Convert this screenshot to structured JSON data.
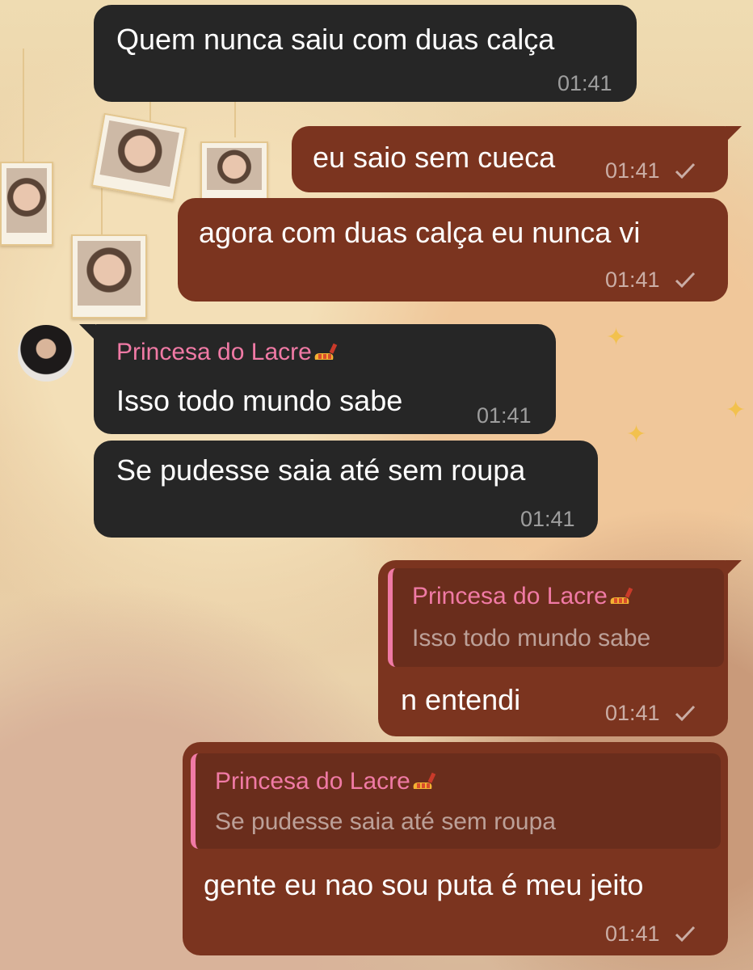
{
  "messages": [
    {
      "text": "Quem nunca saiu com duas calça",
      "time": "01:41"
    },
    {
      "text": "eu saio sem cueca",
      "time": "01:41"
    },
    {
      "text": "agora com duas calça eu nunca vi",
      "time": "01:41"
    },
    {
      "sender": "Princesa do Lacre",
      "text": "Isso todo mundo sabe",
      "time": "01:41"
    },
    {
      "text": "Se pudesse saia até sem roupa",
      "time": "01:41"
    },
    {
      "reply": {
        "name": "Princesa do Lacre",
        "text": "Isso todo mundo sabe"
      },
      "text": "n entendi",
      "time": "01:41"
    },
    {
      "reply": {
        "name": "Princesa do Lacre",
        "text": "Se pudesse saia até sem roupa"
      },
      "text": "gente eu nao sou puta é meu jeito",
      "time": "01:41"
    }
  ],
  "icons": {
    "read_check": "check-icon",
    "sender_emoji": "nail-polish-emoji",
    "avatar": "user-avatar"
  },
  "colors": {
    "incoming_bubble": "#262626",
    "outgoing_bubble": "#7b341f",
    "sender_name": "#f07aa5"
  }
}
